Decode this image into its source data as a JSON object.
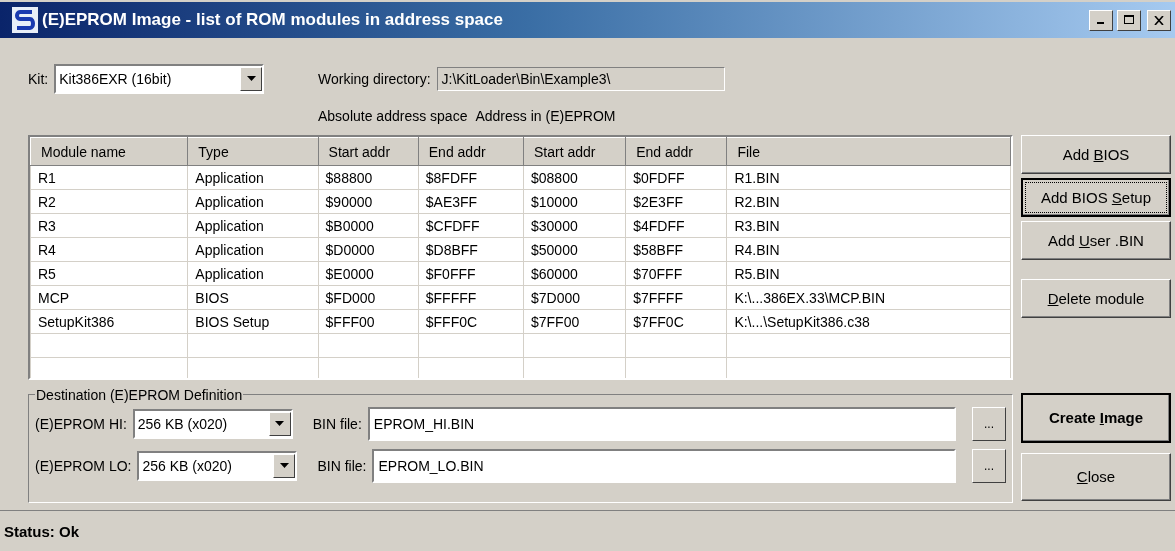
{
  "window": {
    "title": "(E)EPROM Image - list of ROM modules in address space"
  },
  "kit": {
    "label": "Kit:",
    "value": "Kit386EXR (16bit)"
  },
  "working_directory": {
    "label": "Working directory:",
    "value": "J:\\KitLoader\\Bin\\Example3\\"
  },
  "column_groups": [
    "Absolute address space",
    "Address in (E)EPROM"
  ],
  "table": {
    "columns": [
      "Module name",
      "Type",
      "Start addr",
      "End addr",
      "Start addr",
      "End addr",
      "File"
    ],
    "rows": [
      [
        "R1",
        "Application",
        "$88800",
        "$8FDFF",
        "$08800",
        "$0FDFF",
        "R1.BIN"
      ],
      [
        "R2",
        "Application",
        "$90000",
        "$AE3FF",
        "$10000",
        "$2E3FF",
        "R2.BIN"
      ],
      [
        "R3",
        "Application",
        "$B0000",
        "$CFDFF",
        "$30000",
        "$4FDFF",
        "R3.BIN"
      ],
      [
        "R4",
        "Application",
        "$D0000",
        "$D8BFF",
        "$50000",
        "$58BFF",
        "R4.BIN"
      ],
      [
        "R5",
        "Application",
        "$E0000",
        "$F0FFF",
        "$60000",
        "$70FFF",
        "R5.BIN"
      ],
      [
        "MCP",
        "BIOS",
        "$FD000",
        "$FFFFF",
        "$7D000",
        "$7FFFF",
        "K:\\...386EX.33\\MCP.BIN"
      ],
      [
        "SetupKit386",
        "BIOS Setup",
        "$FFF00",
        "$FFF0C",
        "$7FF00",
        "$7FF0C",
        "K:\\...\\SetupKit386.c38"
      ]
    ]
  },
  "side_buttons": [
    {
      "before": "Add ",
      "key": "B",
      "after": "IOS",
      "focused": false
    },
    {
      "before": "Add BIOS ",
      "key": "S",
      "after": "etup",
      "focused": true
    },
    {
      "before": "Add ",
      "key": "U",
      "after": "ser .BIN",
      "focused": false
    },
    {
      "key": "D",
      "after": "elete module",
      "focused": false
    }
  ],
  "destination": {
    "legend": "Destination (E)EPROM Definition",
    "rows": [
      {
        "label": "(E)EPROM HI:",
        "size": "256 KB (x020)",
        "bin_label": "BIN file:",
        "bin_value": "EPROM_HI.BIN",
        "browse": "..."
      },
      {
        "label": "(E)EPROM LO:",
        "size": "256 KB (x020)",
        "bin_label": "BIN file:",
        "bin_value": "EPROM_LO.BIN",
        "browse": "..."
      }
    ]
  },
  "actions": [
    {
      "before": "Create ",
      "key": "I",
      "after": "mage",
      "default": true
    },
    {
      "key": "C",
      "after": "lose",
      "default": false
    }
  ],
  "status_bar": "Status: Ok"
}
